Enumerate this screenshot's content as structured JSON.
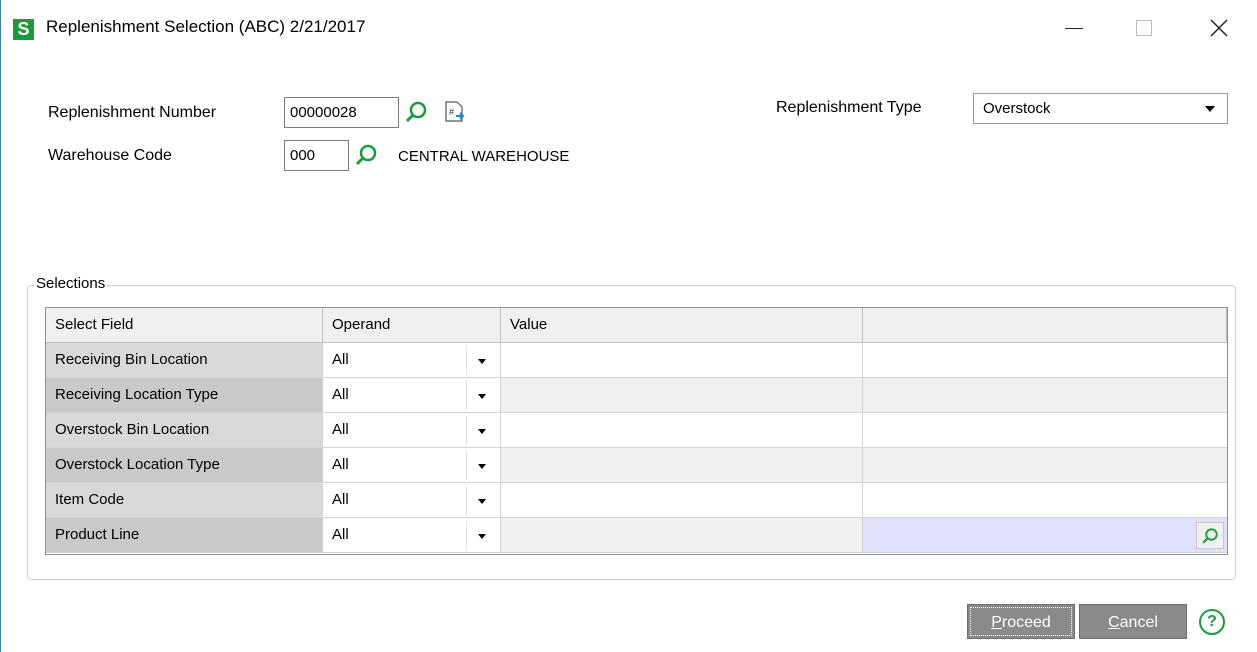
{
  "window": {
    "app_icon_letter": "S",
    "title": "Replenishment Selection (ABC) 2/21/2017"
  },
  "form": {
    "replenishment_number_label": "Replenishment Number",
    "replenishment_number_value": "00000028",
    "warehouse_code_label": "Warehouse Code",
    "warehouse_code_value": "000",
    "warehouse_name": "CENTRAL WAREHOUSE",
    "replenishment_type_label": "Replenishment Type",
    "replenishment_type_value": "Overstock"
  },
  "selections": {
    "group_label": "Selections",
    "headers": [
      "Select Field",
      "Operand",
      "Value",
      ""
    ],
    "rows": [
      {
        "field": "Receiving Bin Location",
        "operand": "All",
        "value": "",
        "extra": ""
      },
      {
        "field": "Receiving Location Type",
        "operand": "All",
        "value": "",
        "extra": ""
      },
      {
        "field": "Overstock Bin Location",
        "operand": "All",
        "value": "",
        "extra": ""
      },
      {
        "field": "Overstock Location Type",
        "operand": "All",
        "value": "",
        "extra": ""
      },
      {
        "field": "Item Code",
        "operand": "All",
        "value": "",
        "extra": ""
      },
      {
        "field": "Product Line",
        "operand": "All",
        "value": "",
        "extra": ""
      }
    ]
  },
  "buttons": {
    "proceed_prefix": "P",
    "proceed_rest": "roceed",
    "cancel_prefix": "C",
    "cancel_rest": "ancel",
    "help_glyph": "?"
  },
  "colors": {
    "accent_green": "#1c9b3a",
    "button_grey": "#8a8a8a",
    "lookup_highlight": "#dfe0fb"
  }
}
